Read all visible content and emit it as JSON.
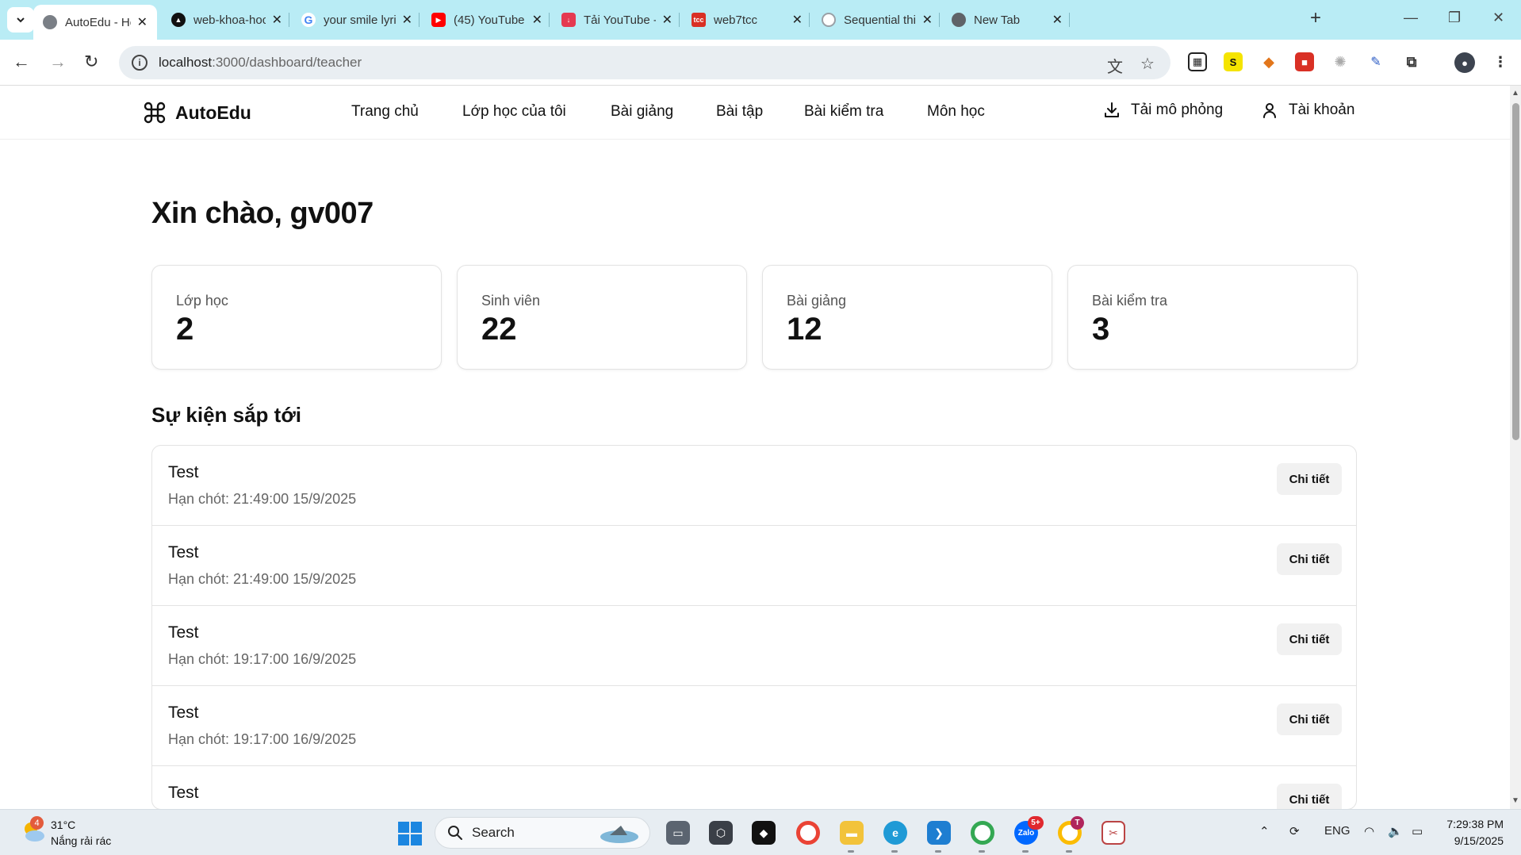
{
  "browser": {
    "tabs": [
      {
        "title": "AutoEdu - Hệ thống",
        "active": true,
        "favicon_color": "#7a7f86"
      },
      {
        "title": "web-khoa-hoc-k",
        "active": false,
        "favicon_color": "#111111"
      },
      {
        "title": "your smile lyrics",
        "active": false,
        "favicon_color": "#4285f4"
      },
      {
        "title": "(45) YouTube",
        "active": false,
        "favicon_color": "#ff0000"
      },
      {
        "title": "Tải YouTube - Tả",
        "active": false,
        "favicon_color": "#e53950"
      },
      {
        "title": "web7tcc",
        "active": false,
        "favicon_color": "#d93025"
      },
      {
        "title": "Sequential think",
        "active": false,
        "favicon_color": "#9aa0a6"
      },
      {
        "title": "New Tab",
        "active": false,
        "favicon_color": "#5f6368"
      }
    ],
    "url_host": "localhost",
    "url_path": ":3000/dashboard/teacher"
  },
  "header": {
    "brand": "AutoEdu",
    "nav": [
      "Trang chủ",
      "Lớp học của tôi",
      "Bài giảng",
      "Bài tập",
      "Bài kiểm tra",
      "Môn học"
    ],
    "download_label": "Tải mô phỏng",
    "account_label": "Tài khoản"
  },
  "main": {
    "greeting": "Xin chào, gv007",
    "stats": [
      {
        "label": "Lớp học",
        "value": "2"
      },
      {
        "label": "Sinh viên",
        "value": "22"
      },
      {
        "label": "Bài giảng",
        "value": "12"
      },
      {
        "label": "Bài kiểm tra",
        "value": "3"
      }
    ],
    "events_title": "Sự kiện sắp tới",
    "events": [
      {
        "name": "Test",
        "deadline": "Hạn chót: 21:49:00 15/9/2025",
        "button": "Chi tiết"
      },
      {
        "name": "Test",
        "deadline": "Hạn chót: 21:49:00 15/9/2025",
        "button": "Chi tiết"
      },
      {
        "name": "Test",
        "deadline": "Hạn chót: 19:17:00 16/9/2025",
        "button": "Chi tiết"
      },
      {
        "name": "Test",
        "deadline": "Hạn chót: 19:17:00 16/9/2025",
        "button": "Chi tiết"
      },
      {
        "name": "Test",
        "deadline": "",
        "button": "Chi tiết"
      }
    ]
  },
  "taskbar": {
    "weather_temp": "31°C",
    "weather_desc": "Nắng rải rác",
    "weather_badge": "4",
    "search_label": "Search",
    "language": "ENG",
    "time": "7:29:38 PM",
    "date": "9/15/2025",
    "zalo_badge": "5+",
    "chrome_badge": "T"
  }
}
